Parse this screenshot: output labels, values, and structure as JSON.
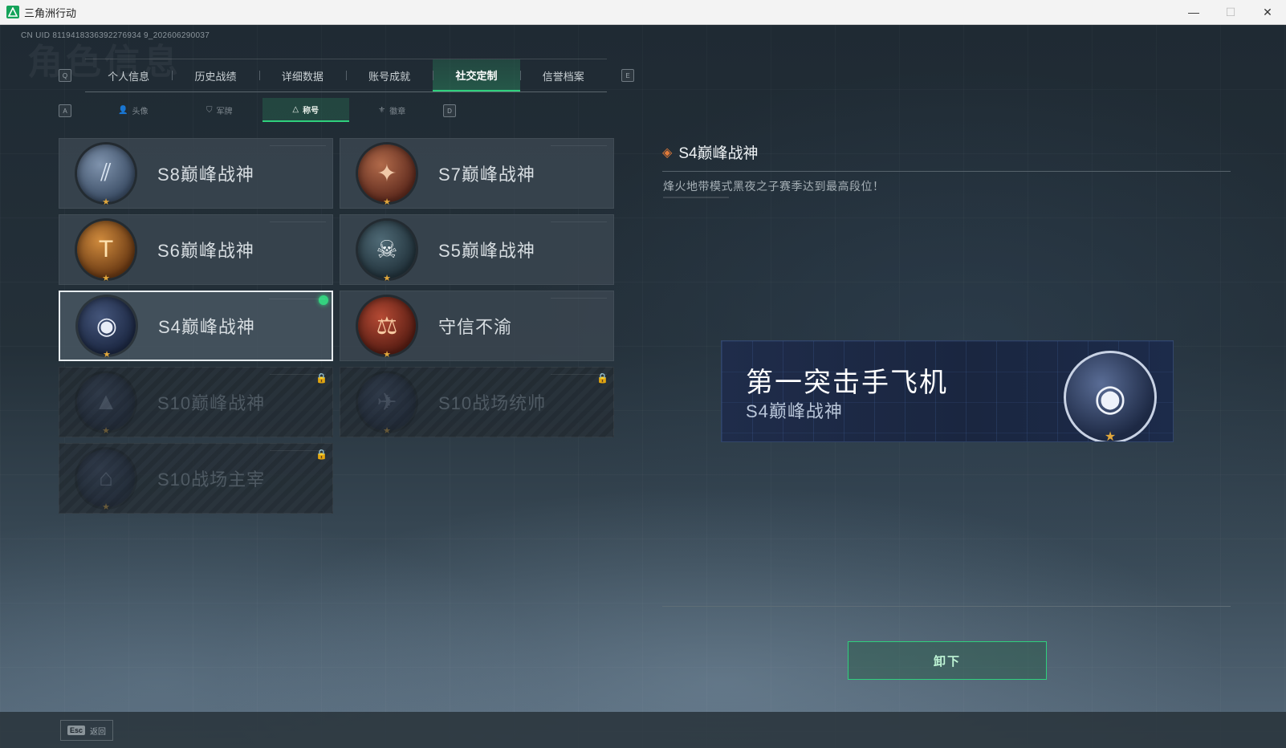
{
  "window": {
    "title": "三角洲行动",
    "minimize": "—",
    "maximize": "☐",
    "close": "✕"
  },
  "uid": "CN UID 8119418336392276934 9_202606290037",
  "background_heading": "角色信息",
  "main_tabs": {
    "prev_key": "Q",
    "next_key": "E",
    "items": [
      {
        "label": "个人信息"
      },
      {
        "label": "历史战绩"
      },
      {
        "label": "详细数据"
      },
      {
        "label": "账号成就"
      },
      {
        "label": "社交定制",
        "active": true
      },
      {
        "label": "信誉档案"
      }
    ]
  },
  "sub_tabs": {
    "prev_key": "A",
    "next_key": "D",
    "items": [
      {
        "label": "头像",
        "icon": "person-icon"
      },
      {
        "label": "军牌",
        "icon": "tag-icon"
      },
      {
        "label": "称号",
        "icon": "triangle-icon",
        "active": true
      },
      {
        "label": "徽章",
        "icon": "wings-icon"
      }
    ]
  },
  "titles": [
    {
      "label": "S8巅峰战神",
      "icon": "slash-emblem-icon",
      "glyph": "⫽",
      "color": "b-blue",
      "locked": false,
      "equipped": false,
      "selected": false
    },
    {
      "label": "S7巅峰战神",
      "icon": "rifle-emblem-icon",
      "glyph": "✦",
      "color": "b-rust",
      "locked": false,
      "equipped": false,
      "selected": false
    },
    {
      "label": "S6巅峰战神",
      "icon": "t-shield-emblem-icon",
      "glyph": "T",
      "color": "b-gold",
      "locked": false,
      "equipped": false,
      "selected": false
    },
    {
      "label": "S5巅峰战神",
      "icon": "skull-goggles-emblem-icon",
      "glyph": "☠",
      "color": "b-teal",
      "locked": false,
      "equipped": false,
      "selected": false
    },
    {
      "label": "S4巅峰战神",
      "icon": "night-vision-helmet-emblem-icon",
      "glyph": "◉",
      "color": "b-navy",
      "locked": false,
      "equipped": true,
      "selected": true
    },
    {
      "label": "守信不渝",
      "icon": "scales-emblem-icon",
      "glyph": "⚖",
      "color": "b-red",
      "locked": false,
      "equipped": false,
      "selected": false
    },
    {
      "label": "S10巅峰战神",
      "icon": "building-emblem-icon",
      "glyph": "▲",
      "color": "b-dark",
      "locked": true,
      "equipped": false,
      "selected": false
    },
    {
      "label": "S10战场统帅",
      "icon": "aircraft-emblem-icon",
      "glyph": "✈",
      "color": "b-dark",
      "locked": true,
      "equipped": false,
      "selected": false
    },
    {
      "label": "S10战场主宰",
      "icon": "colosseum-emblem-icon",
      "glyph": "⌂",
      "color": "b-dark",
      "locked": true,
      "equipped": false,
      "selected": false
    }
  ],
  "detail": {
    "title": "S4巅峰战神",
    "description": "烽火地带模式黑夜之子赛季达到最高段位！",
    "preview_nickname": "第一突击手飞机",
    "preview_title": "S4巅峰战神",
    "action_button": "卸下"
  },
  "footer": {
    "esc_key": "Esc",
    "back_label": "返回"
  },
  "colors": {
    "accent_green": "#2fd07d",
    "equipped_dot": "#34d27f",
    "star_gold": "#e0a73c"
  }
}
